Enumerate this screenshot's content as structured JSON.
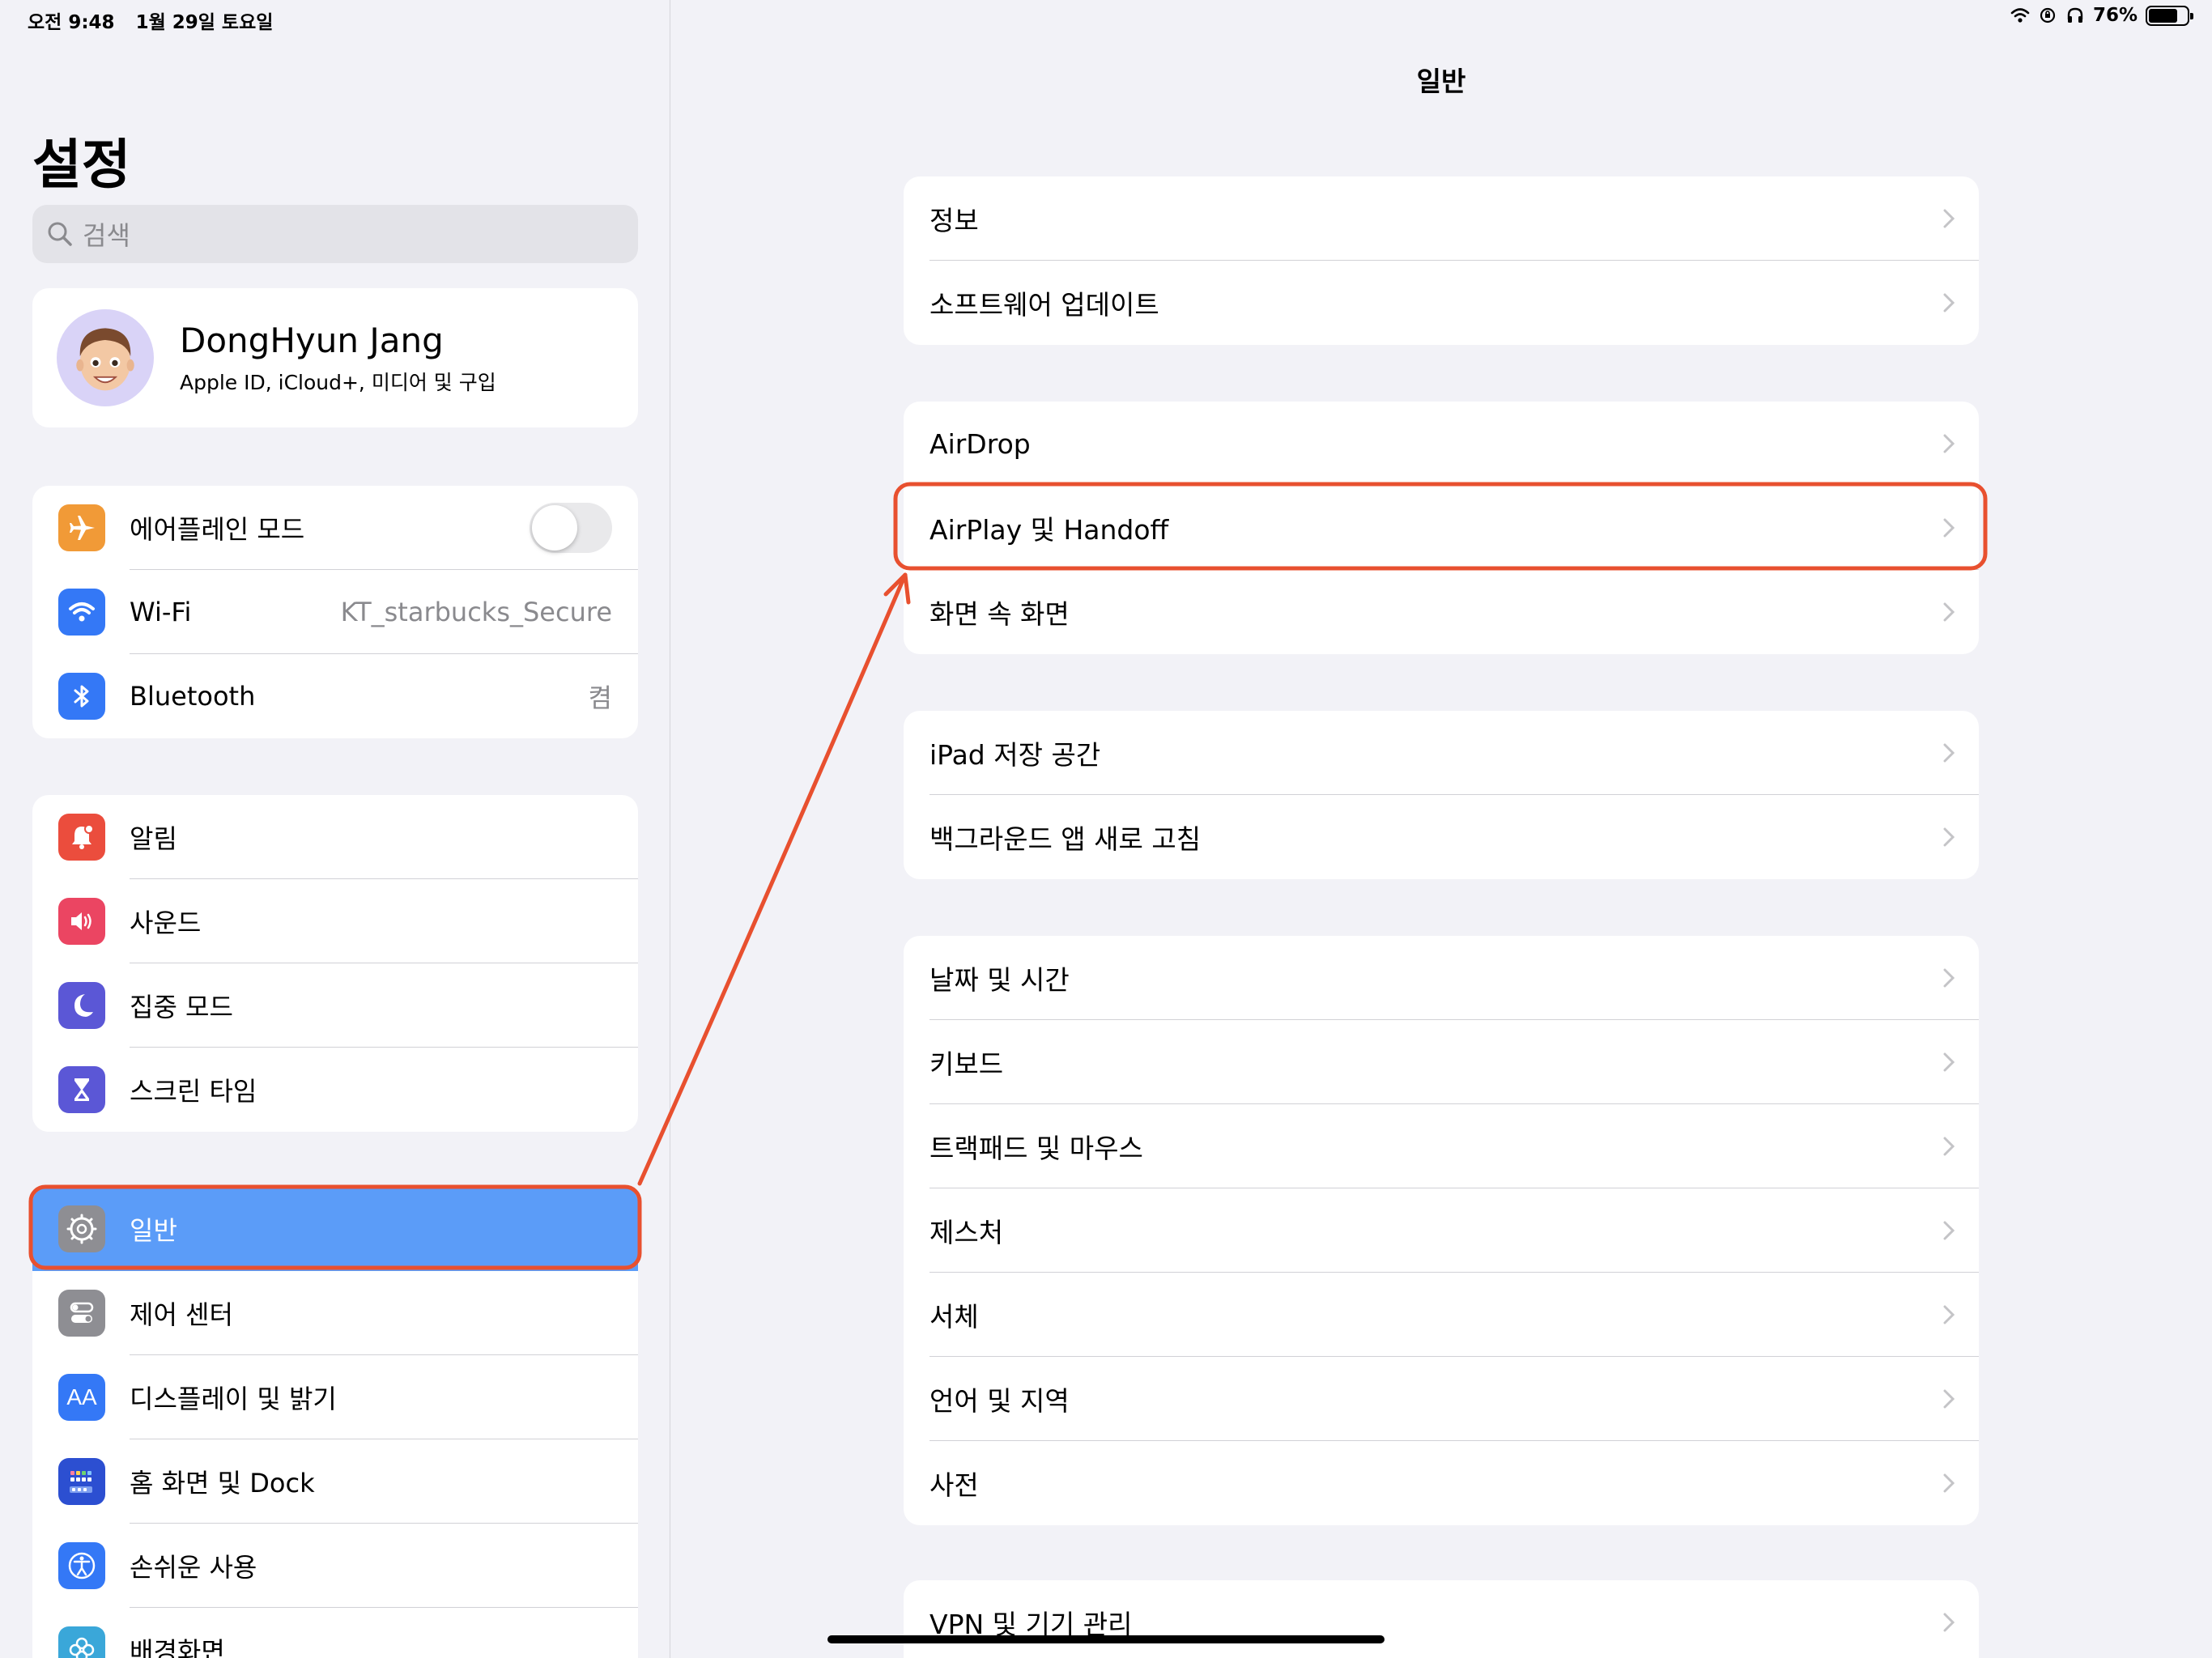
{
  "status_bar": {
    "time": "오전 9:48",
    "date": "1월 29일 토요일",
    "battery": "76%",
    "battery_level": 0.76
  },
  "sidebar": {
    "title": "설정",
    "search_placeholder": "검색",
    "profile": {
      "name": "DongHyun Jang",
      "subtitle": "Apple ID, iCloud+, 미디어 및 구입"
    },
    "group1": [
      {
        "label": "에어플레인 모드",
        "icon": "airplane-icon",
        "color": "#f19a37",
        "toggle": false
      },
      {
        "label": "Wi-Fi",
        "value": "KT_starbucks_Secure",
        "icon": "wifi-icon",
        "color": "#3478f6"
      },
      {
        "label": "Bluetooth",
        "value": "켬",
        "icon": "bluetooth-icon",
        "color": "#3478f6"
      }
    ],
    "group2": [
      {
        "label": "알림",
        "icon": "bell-icon",
        "color": "#eb4d3d"
      },
      {
        "label": "사운드",
        "icon": "speaker-icon",
        "color": "#eb4562"
      },
      {
        "label": "집중 모드",
        "icon": "moon-icon",
        "color": "#5b57d6"
      },
      {
        "label": "스크린 타임",
        "icon": "hourglass-icon",
        "color": "#5b57d6"
      }
    ],
    "group3": [
      {
        "label": "일반",
        "icon": "gear-icon",
        "color": "#8e8e93",
        "selected": true
      },
      {
        "label": "제어 센터",
        "icon": "toggles-icon",
        "color": "#8e8e93"
      },
      {
        "label": "디스플레이 및 밝기",
        "icon": "text-size-icon",
        "color": "#3478f6",
        "icon_text": "AA"
      },
      {
        "label": "홈 화면 및 Dock",
        "icon": "grid-icon",
        "color": "#2c4fd1"
      },
      {
        "label": "손쉬운 사용",
        "icon": "accessibility-icon",
        "color": "#3478f6"
      },
      {
        "label": "배경화면",
        "icon": "flower-icon",
        "color": "#3aa7d9"
      }
    ]
  },
  "main": {
    "title": "일반",
    "groups": [
      [
        "정보",
        "소프트웨어 업데이트"
      ],
      [
        "AirDrop",
        "AirPlay 및 Handoff",
        "화면 속 화면"
      ],
      [
        "iPad 저장 공간",
        "백그라운드 앱 새로 고침"
      ],
      [
        "날짜 및 시간",
        "키보드",
        "트랙패드 및 마우스",
        "제스처",
        "서체",
        "언어 및 지역",
        "사전"
      ],
      [
        "VPN 및 기기 관리"
      ]
    ]
  },
  "annotation": {
    "color": "#e8502f"
  }
}
